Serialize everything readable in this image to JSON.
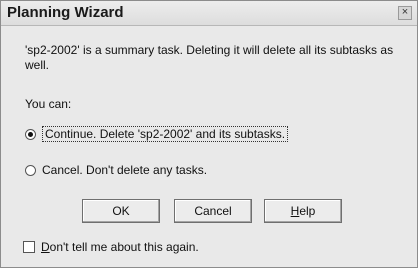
{
  "dialog": {
    "title": "Planning Wizard",
    "close_glyph": "×",
    "message": "'sp2-2002' is a summary task.  Deleting it will delete all its subtasks as well.",
    "you_can": "You can:",
    "options": [
      {
        "label": "Continue.  Delete 'sp2-2002' and its subtasks.",
        "selected": true
      },
      {
        "label": "Cancel.  Don't delete any tasks.",
        "selected": false
      }
    ],
    "buttons": {
      "ok": "OK",
      "cancel": "Cancel",
      "help_first": "H",
      "help_rest": "elp"
    },
    "dont_tell": {
      "first": "D",
      "rest": "on't tell me about this again.",
      "checked": false
    }
  }
}
